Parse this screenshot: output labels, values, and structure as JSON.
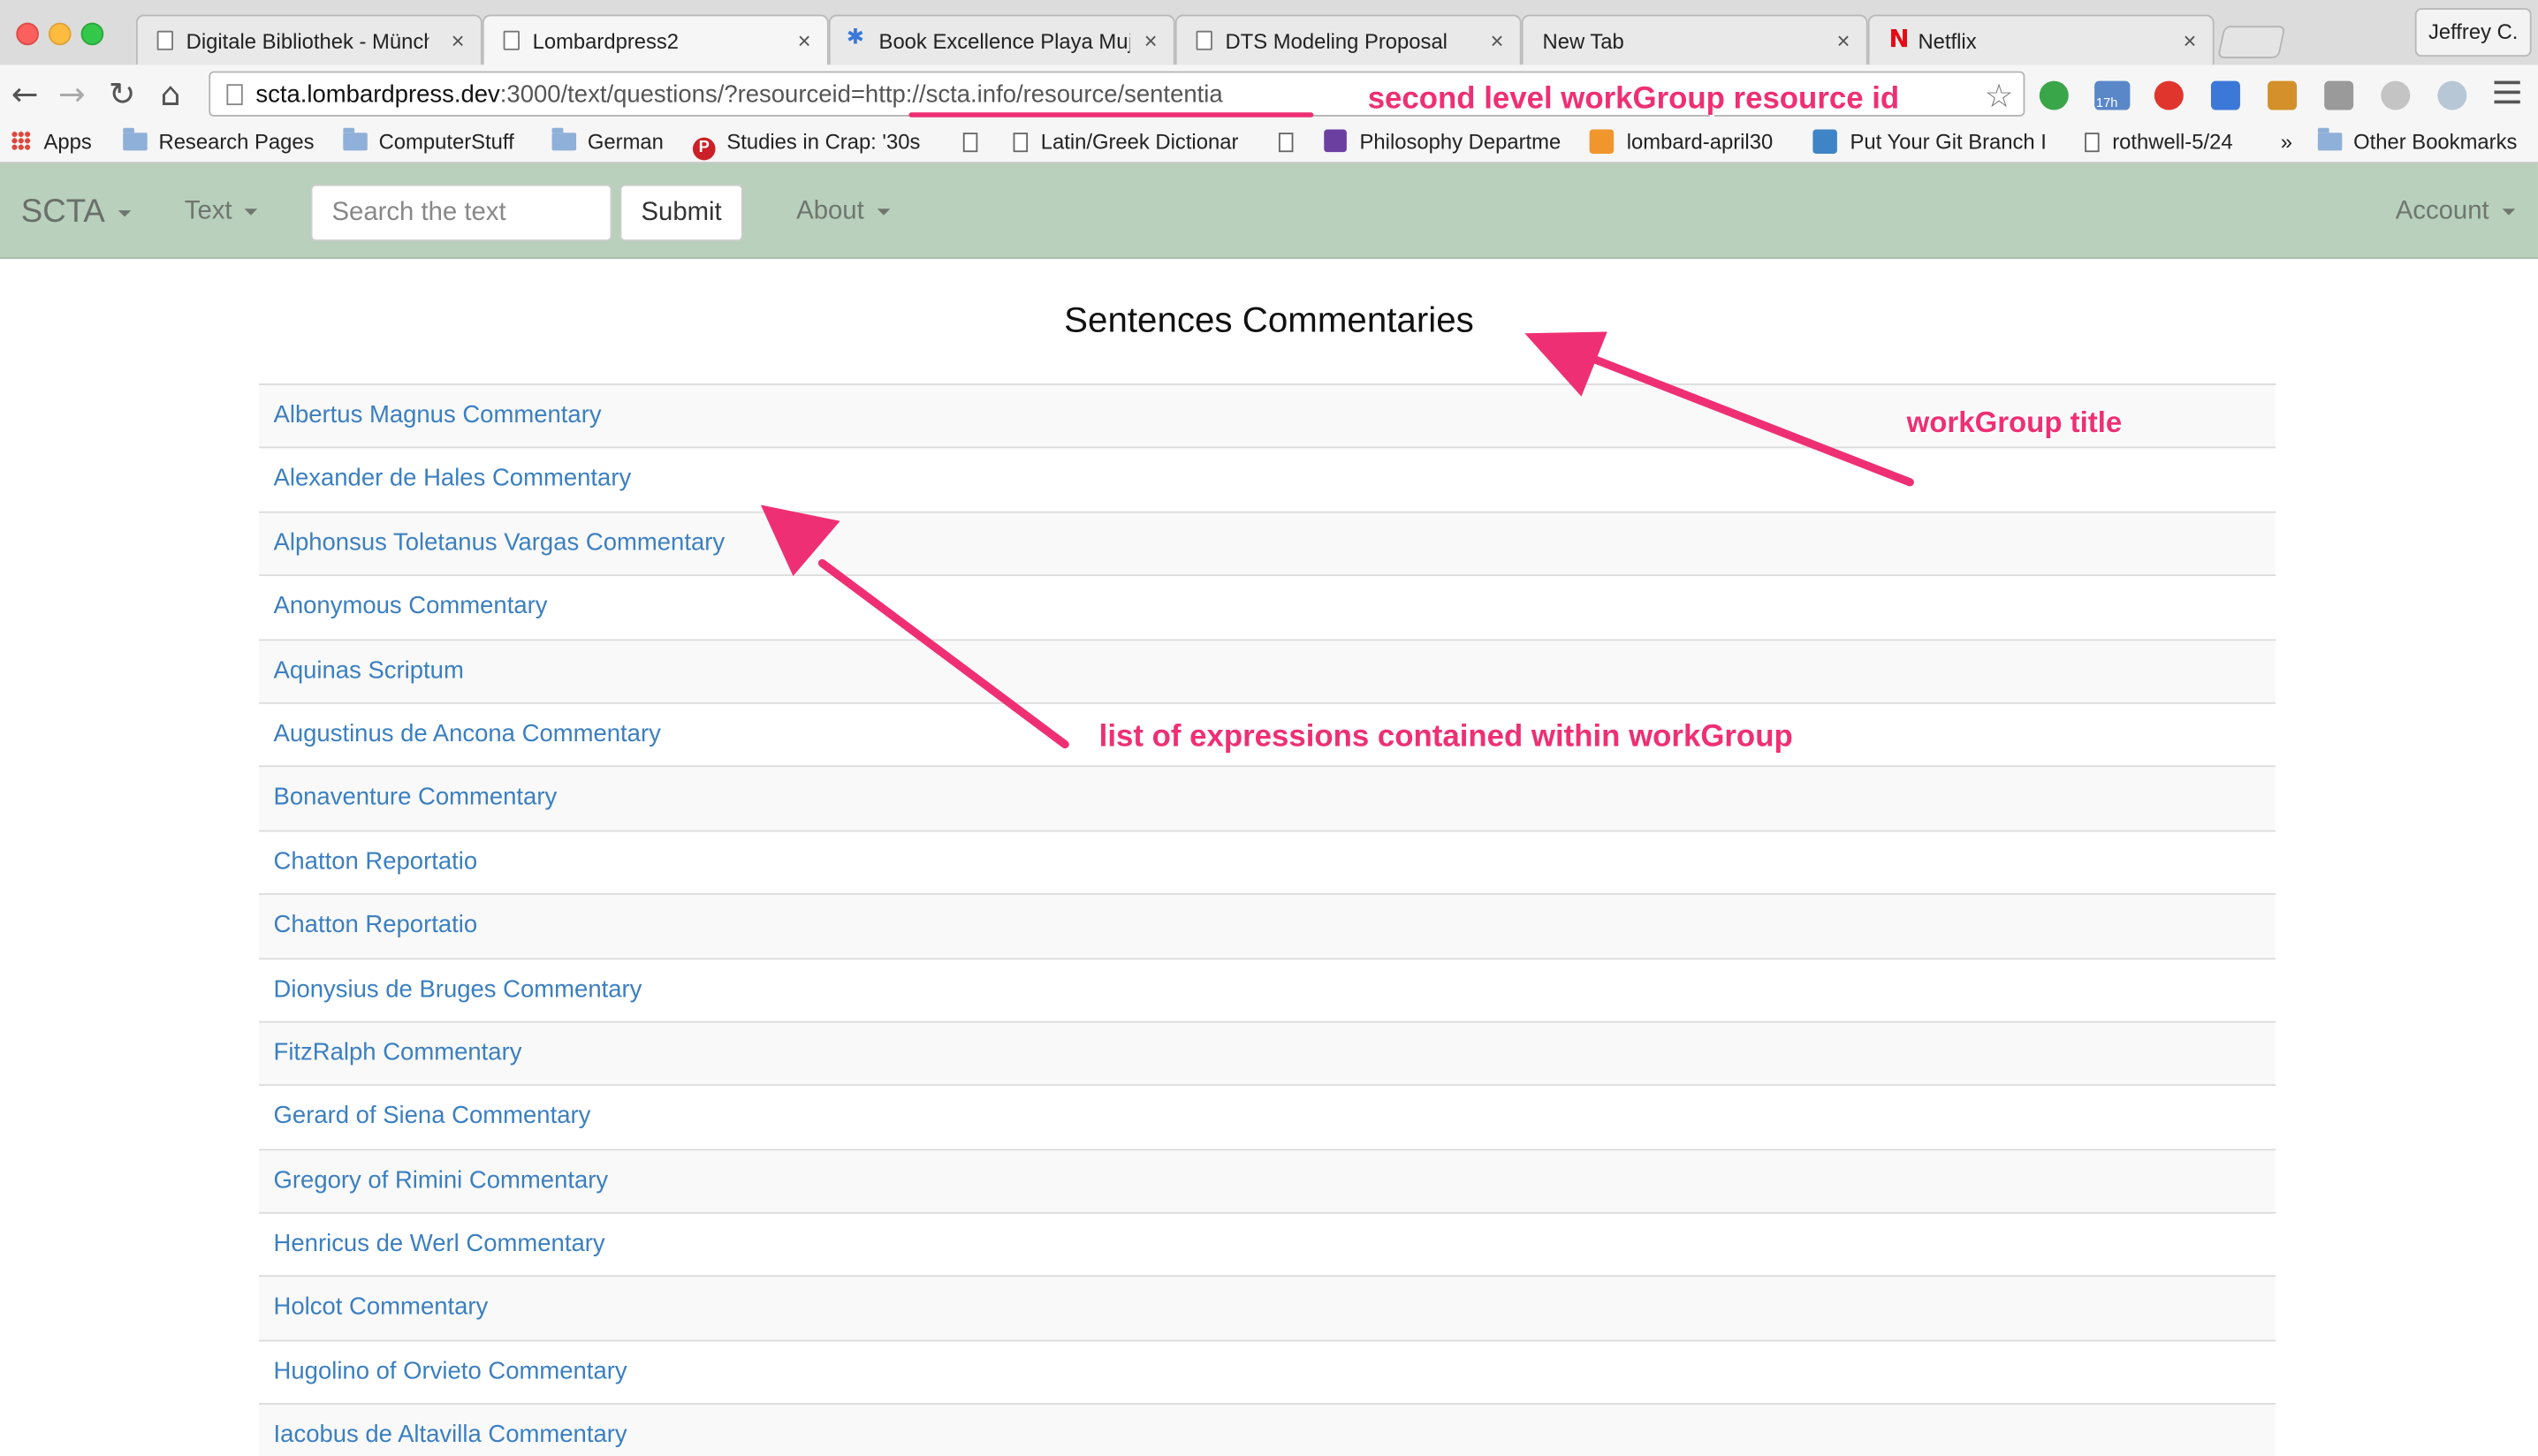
{
  "browser": {
    "tabs": [
      {
        "title": "Digitale Bibliothek - Münch",
        "close": "×",
        "favicon": "document-icon"
      },
      {
        "title": "Lombardpress2",
        "close": "×",
        "favicon": "document-icon",
        "active": true
      },
      {
        "title": "Book Excellence Playa Muje",
        "close": "×",
        "favicon": "book-icon"
      },
      {
        "title": "DTS Modeling Proposal",
        "close": "×",
        "favicon": "document-icon"
      },
      {
        "title": "New Tab",
        "close": "×",
        "favicon": "none"
      },
      {
        "title": "Netflix",
        "close": "×",
        "favicon": "netflix-icon"
      }
    ],
    "profile_name": "Jeffrey C.",
    "url_host": "scta.lombardpress.dev",
    "url_rest": ":3000/text/questions/?resourceid=http://scta.info/resource/sententia",
    "extension_badge": "17h",
    "bookmarks": [
      {
        "label": "Apps",
        "icon": "apps-icon"
      },
      {
        "label": "Research Pages",
        "icon": "folder-icon"
      },
      {
        "label": "ComputerStuff",
        "icon": "folder-icon"
      },
      {
        "label": "German",
        "icon": "folder-icon"
      },
      {
        "label": "Studies in Crap: '30s",
        "icon": "pinterest-icon"
      },
      {
        "label": "",
        "icon": "document-icon"
      },
      {
        "label": "Latin/Greek Dictionar",
        "icon": "document-icon"
      },
      {
        "label": "",
        "icon": "document-icon"
      },
      {
        "label": "Philosophy Departme",
        "icon": "list-icon"
      },
      {
        "label": "lombard-april30",
        "icon": "orange-icon"
      },
      {
        "label": "Put Your Git Branch I",
        "icon": "branch-icon"
      },
      {
        "label": "rothwell-5/24",
        "icon": "document-icon"
      },
      {
        "label": "»",
        "icon": "none"
      },
      {
        "label": "Other Bookmarks",
        "icon": "folder-icon"
      }
    ]
  },
  "navbar": {
    "brand": "SCTA",
    "text_menu": "Text",
    "search_placeholder": "Search the text",
    "submit_label": "Submit",
    "about_menu": "About",
    "account_menu": "Account"
  },
  "main": {
    "title": "Sentences Commentaries",
    "items": [
      "Albertus Magnus Commentary",
      "Alexander de Hales Commentary",
      "Alphonsus Toletanus Vargas Commentary",
      "Anonymous Commentary",
      "Aquinas Scriptum",
      "Augustinus de Ancona Commentary",
      "Bonaventure Commentary",
      "Chatton Reportatio",
      "Chatton Reportatio",
      "Dionysius de Bruges Commentary",
      "FitzRalph Commentary",
      "Gerard of Siena Commentary",
      "Gregory of Rimini Commentary",
      "Henricus de Werl Commentary",
      "Holcot Commentary",
      "Hugolino of Orvieto Commentary",
      "Iacobus de Altavilla Commentary"
    ]
  },
  "annotations": {
    "resource_id": "second level workGroup resource id",
    "title": "workGroup title",
    "list": "list of expressions contained within workGroup",
    "color": "#ef2f74"
  }
}
